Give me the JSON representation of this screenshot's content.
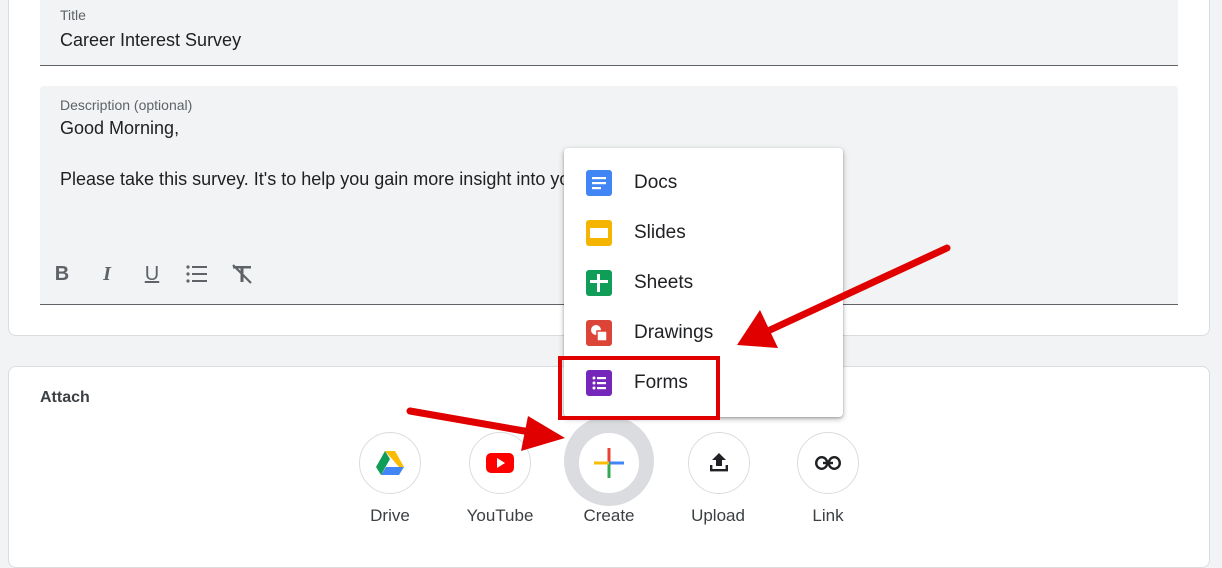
{
  "title_field": {
    "label": "Title",
    "value": "Career Interest Survey"
  },
  "description_field": {
    "label": "Description (optional)",
    "line1": "Good Morning,",
    "line2": "Please take this survey. It's to help you gain more insight into yo"
  },
  "format_toolbar": {
    "bold_icon": "B",
    "italic_icon": "I",
    "underline_icon": "U"
  },
  "attach": {
    "title": "Attach",
    "buttons": [
      {
        "label": "Drive",
        "icon": "google-drive-icon"
      },
      {
        "label": "YouTube",
        "icon": "youtube-icon"
      },
      {
        "label": "Create",
        "icon": "plus-icon"
      },
      {
        "label": "Upload",
        "icon": "upload-icon"
      },
      {
        "label": "Link",
        "icon": "link-icon"
      }
    ]
  },
  "create_menu": {
    "items": [
      {
        "label": "Docs",
        "icon": "docs-icon",
        "color": "#4285f4"
      },
      {
        "label": "Slides",
        "icon": "slides-icon",
        "color": "#f4b400"
      },
      {
        "label": "Sheets",
        "icon": "sheets-icon",
        "color": "#0f9d58"
      },
      {
        "label": "Drawings",
        "icon": "drawings-icon",
        "color": "#db4437"
      },
      {
        "label": "Forms",
        "icon": "forms-icon",
        "color": "#7627bb"
      }
    ]
  },
  "annotation_color": "#e00000"
}
